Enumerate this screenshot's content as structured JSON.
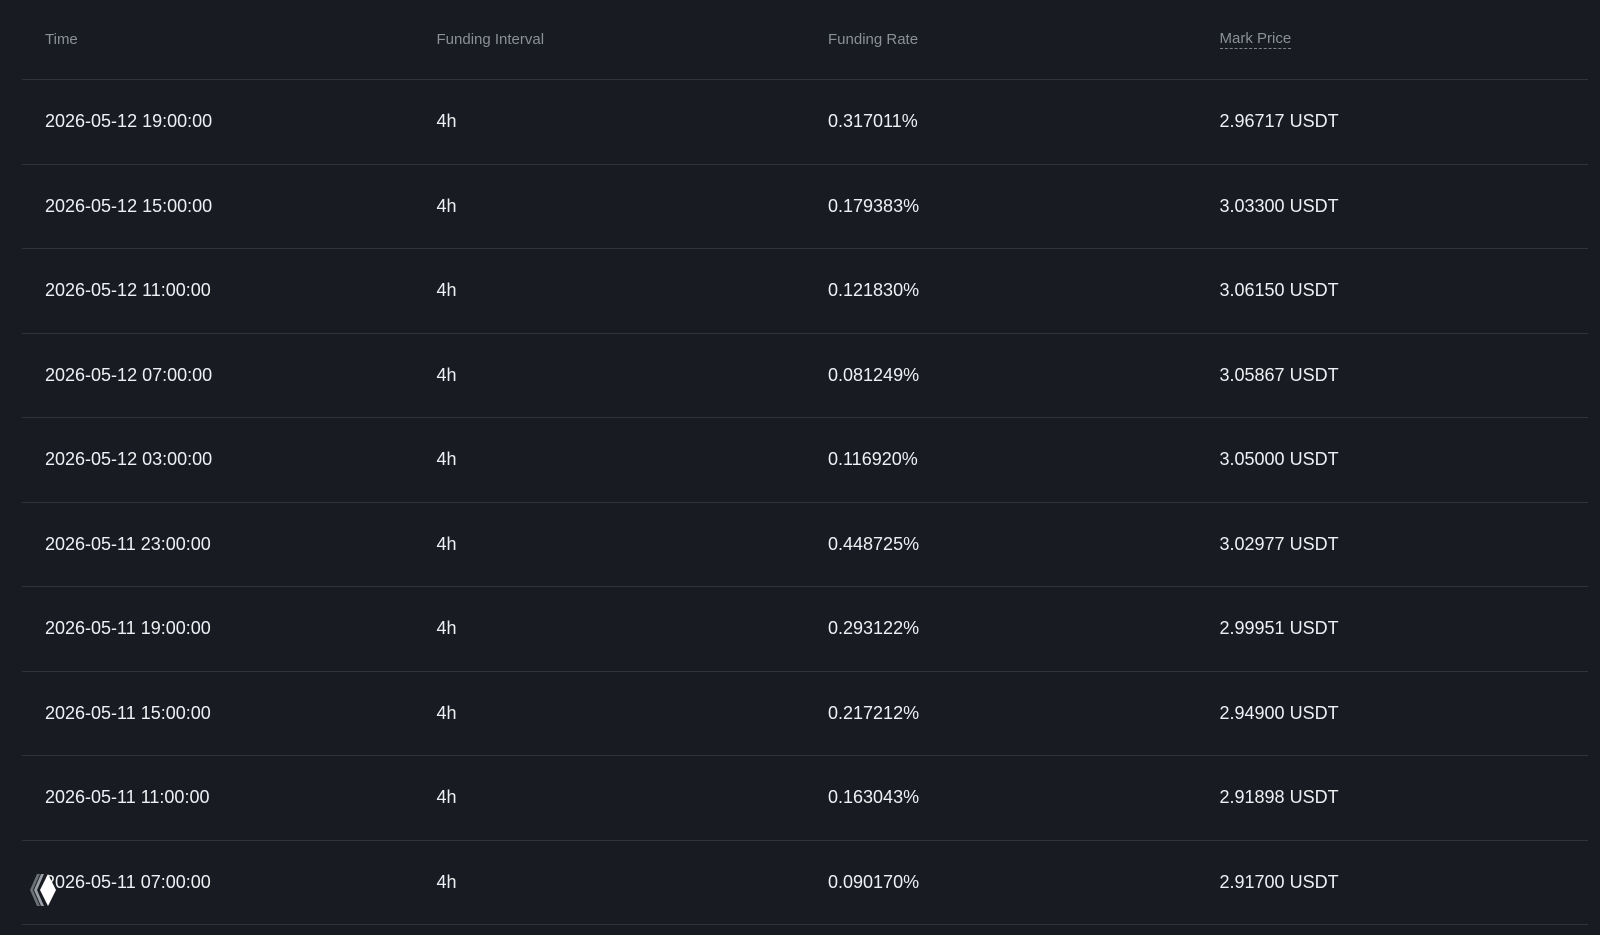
{
  "table": {
    "columns": [
      "Time",
      "Funding Interval",
      "Funding Rate",
      "Mark Price"
    ],
    "rows": [
      {
        "time": "2026-05-12 19:00:00",
        "interval": "4h",
        "rate": "0.317011%",
        "price": "2.96717 USDT"
      },
      {
        "time": "2026-05-12 15:00:00",
        "interval": "4h",
        "rate": "0.179383%",
        "price": "3.03300 USDT"
      },
      {
        "time": "2026-05-12 11:00:00",
        "interval": "4h",
        "rate": "0.121830%",
        "price": "3.06150 USDT"
      },
      {
        "time": "2026-05-12 07:00:00",
        "interval": "4h",
        "rate": "0.081249%",
        "price": "3.05867 USDT"
      },
      {
        "time": "2026-05-12 03:00:00",
        "interval": "4h",
        "rate": "0.116920%",
        "price": "3.05000 USDT"
      },
      {
        "time": "2026-05-11 23:00:00",
        "interval": "4h",
        "rate": "0.448725%",
        "price": "3.02977 USDT"
      },
      {
        "time": "2026-05-11 19:00:00",
        "interval": "4h",
        "rate": "0.293122%",
        "price": "2.99951 USDT"
      },
      {
        "time": "2026-05-11 15:00:00",
        "interval": "4h",
        "rate": "0.217212%",
        "price": "2.94900 USDT"
      },
      {
        "time": "2026-05-11 11:00:00",
        "interval": "4h",
        "rate": "0.163043%",
        "price": "2.91898 USDT"
      },
      {
        "time": "2026-05-11 07:00:00",
        "interval": "4h",
        "rate": "0.090170%",
        "price": "2.91700 USDT"
      }
    ]
  },
  "floating_widget": {
    "icon": "diamond-logo-icon"
  },
  "colors": {
    "background": "#181b21",
    "divider": "#2e333c",
    "header_text": "#8a8f99",
    "body_text": "#eef0f3"
  }
}
